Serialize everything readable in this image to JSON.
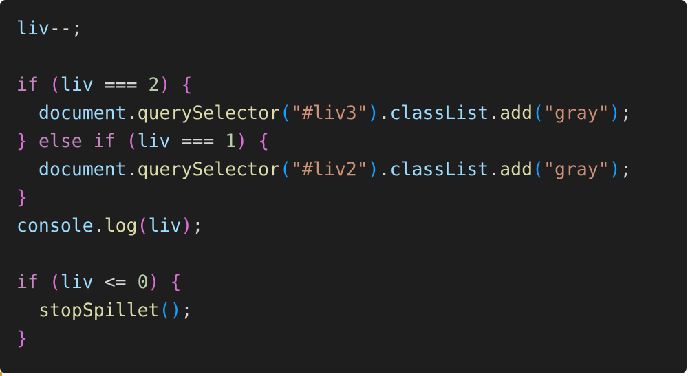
{
  "editor": {
    "theme": "dark",
    "colors": {
      "background": "#1e1e1e",
      "variable": "#9cdcfe",
      "control_keyword": "#c586c0",
      "function": "#dcdcaa",
      "string": "#ce9178",
      "number": "#b5cea8",
      "operator": "#d4d4d4",
      "punctuation": "#d4d4d4",
      "bracket_level_1": "#da70d6",
      "bracket_level_2": "#179fff",
      "indent_guide": "#404040"
    },
    "lines": [
      {
        "indent": 0,
        "tokens": [
          {
            "t": "liv",
            "c": "variable"
          },
          {
            "t": "--;",
            "c": "operator"
          }
        ]
      },
      {
        "indent": 0,
        "tokens": []
      },
      {
        "indent": 0,
        "tokens": [
          {
            "t": "if",
            "c": "control_keyword"
          },
          {
            "t": " ",
            "c": "punctuation"
          },
          {
            "t": "(",
            "c": "bracket_level_1"
          },
          {
            "t": "liv",
            "c": "variable"
          },
          {
            "t": " === ",
            "c": "operator"
          },
          {
            "t": "2",
            "c": "number"
          },
          {
            "t": ")",
            "c": "bracket_level_1"
          },
          {
            "t": " ",
            "c": "punctuation"
          },
          {
            "t": "{",
            "c": "bracket_level_1"
          }
        ]
      },
      {
        "indent": 1,
        "tokens": [
          {
            "t": "document",
            "c": "variable"
          },
          {
            "t": ".",
            "c": "punctuation"
          },
          {
            "t": "querySelector",
            "c": "function"
          },
          {
            "t": "(",
            "c": "bracket_level_2"
          },
          {
            "t": "\"#liv3\"",
            "c": "string"
          },
          {
            "t": ")",
            "c": "bracket_level_2"
          },
          {
            "t": ".",
            "c": "punctuation"
          },
          {
            "t": "classList",
            "c": "variable"
          },
          {
            "t": ".",
            "c": "punctuation"
          },
          {
            "t": "add",
            "c": "function"
          },
          {
            "t": "(",
            "c": "bracket_level_2"
          },
          {
            "t": "\"gray\"",
            "c": "string"
          },
          {
            "t": ")",
            "c": "bracket_level_2"
          },
          {
            "t": ";",
            "c": "punctuation"
          }
        ]
      },
      {
        "indent": 0,
        "tokens": [
          {
            "t": "}",
            "c": "bracket_level_1"
          },
          {
            "t": " ",
            "c": "punctuation"
          },
          {
            "t": "else",
            "c": "control_keyword"
          },
          {
            "t": " ",
            "c": "punctuation"
          },
          {
            "t": "if",
            "c": "control_keyword"
          },
          {
            "t": " ",
            "c": "punctuation"
          },
          {
            "t": "(",
            "c": "bracket_level_1"
          },
          {
            "t": "liv",
            "c": "variable"
          },
          {
            "t": " === ",
            "c": "operator"
          },
          {
            "t": "1",
            "c": "number"
          },
          {
            "t": ")",
            "c": "bracket_level_1"
          },
          {
            "t": " ",
            "c": "punctuation"
          },
          {
            "t": "{",
            "c": "bracket_level_1"
          }
        ]
      },
      {
        "indent": 1,
        "tokens": [
          {
            "t": "document",
            "c": "variable"
          },
          {
            "t": ".",
            "c": "punctuation"
          },
          {
            "t": "querySelector",
            "c": "function"
          },
          {
            "t": "(",
            "c": "bracket_level_2"
          },
          {
            "t": "\"#liv2\"",
            "c": "string"
          },
          {
            "t": ")",
            "c": "bracket_level_2"
          },
          {
            "t": ".",
            "c": "punctuation"
          },
          {
            "t": "classList",
            "c": "variable"
          },
          {
            "t": ".",
            "c": "punctuation"
          },
          {
            "t": "add",
            "c": "function"
          },
          {
            "t": "(",
            "c": "bracket_level_2"
          },
          {
            "t": "\"gray\"",
            "c": "string"
          },
          {
            "t": ")",
            "c": "bracket_level_2"
          },
          {
            "t": ";",
            "c": "punctuation"
          }
        ]
      },
      {
        "indent": 0,
        "tokens": [
          {
            "t": "}",
            "c": "bracket_level_1"
          }
        ]
      },
      {
        "indent": 0,
        "tokens": [
          {
            "t": "console",
            "c": "variable"
          },
          {
            "t": ".",
            "c": "punctuation"
          },
          {
            "t": "log",
            "c": "function"
          },
          {
            "t": "(",
            "c": "bracket_level_1"
          },
          {
            "t": "liv",
            "c": "variable"
          },
          {
            "t": ")",
            "c": "bracket_level_1"
          },
          {
            "t": ";",
            "c": "punctuation"
          }
        ]
      },
      {
        "indent": 0,
        "tokens": []
      },
      {
        "indent": 0,
        "tokens": [
          {
            "t": "if",
            "c": "control_keyword"
          },
          {
            "t": " ",
            "c": "punctuation"
          },
          {
            "t": "(",
            "c": "bracket_level_1"
          },
          {
            "t": "liv",
            "c": "variable"
          },
          {
            "t": " <= ",
            "c": "operator"
          },
          {
            "t": "0",
            "c": "number"
          },
          {
            "t": ")",
            "c": "bracket_level_1"
          },
          {
            "t": " ",
            "c": "punctuation"
          },
          {
            "t": "{",
            "c": "bracket_level_1"
          }
        ]
      },
      {
        "indent": 1,
        "tokens": [
          {
            "t": "stopSpillet",
            "c": "function"
          },
          {
            "t": "(",
            "c": "bracket_level_2"
          },
          {
            "t": ")",
            "c": "bracket_level_2"
          },
          {
            "t": ";",
            "c": "punctuation"
          }
        ]
      },
      {
        "indent": 0,
        "tokens": [
          {
            "t": "}",
            "c": "bracket_level_1"
          }
        ]
      }
    ]
  }
}
